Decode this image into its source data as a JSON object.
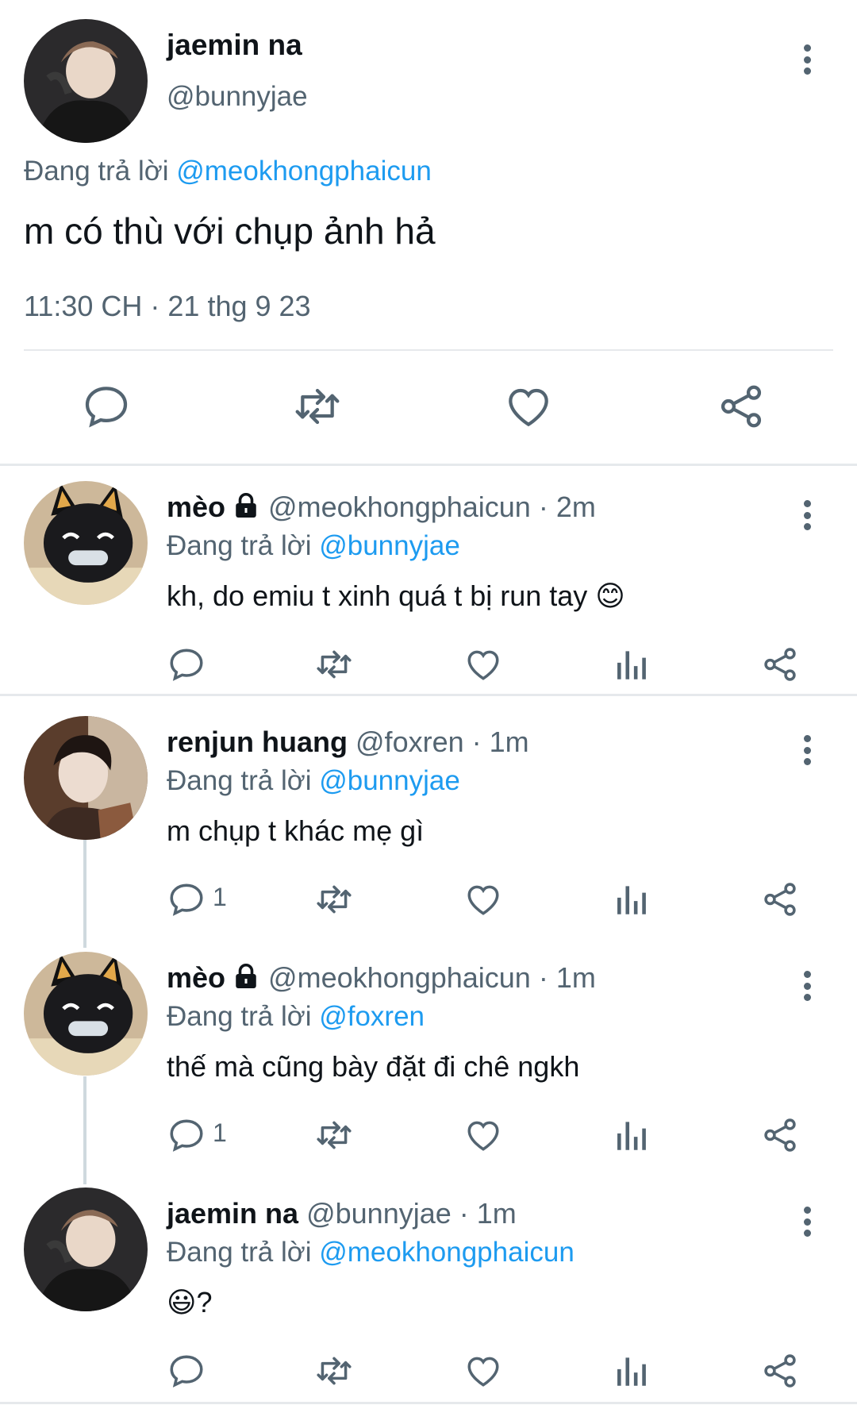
{
  "main_tweet": {
    "name": "jaemin na",
    "handle": "@bunnyjae",
    "replying_prefix": "Đang trả lời ",
    "replying_to": "@meokhongphaicun",
    "text": "m có thù với chụp ảnh hả",
    "timestamp": "11:30 CH · 21 thg 9 23",
    "actions": [
      "reply-icon",
      "retweet-icon",
      "like-icon",
      "share-icon"
    ]
  },
  "replies": [
    {
      "name": "mèo",
      "locked": true,
      "handle": "@meokhongphaicun",
      "time": "2m",
      "replying_prefix": "Đang trả lời ",
      "replying_to": "@bunnyjae",
      "text": "kh, do emiu t xinh quá t bị run tay 😊",
      "reply_count": ""
    },
    {
      "name": "renjun huang",
      "locked": false,
      "handle": "@foxren",
      "time": "1m",
      "replying_prefix": "Đang trả lời ",
      "replying_to": "@bunnyjae",
      "text": "m chụp t khác mẹ gì",
      "reply_count": "1"
    },
    {
      "name": "mèo",
      "locked": true,
      "handle": "@meokhongphaicun",
      "time": "1m",
      "replying_prefix": "Đang trả lời ",
      "replying_to": "@foxren",
      "text": "thế mà cũng bày đặt đi chê ngkh",
      "reply_count": "1"
    },
    {
      "name": "jaemin na",
      "locked": false,
      "handle": "@bunnyjae",
      "time": "1m",
      "replying_prefix": "Đang trả lời ",
      "replying_to": "@meokhongphaicun",
      "text": "😃?",
      "reply_count": ""
    }
  ],
  "separator": " · ",
  "colors": {
    "text": "#0f1419",
    "secondary": "#536471",
    "mention": "#1d9bf0",
    "divider": "#e6e9ec"
  }
}
